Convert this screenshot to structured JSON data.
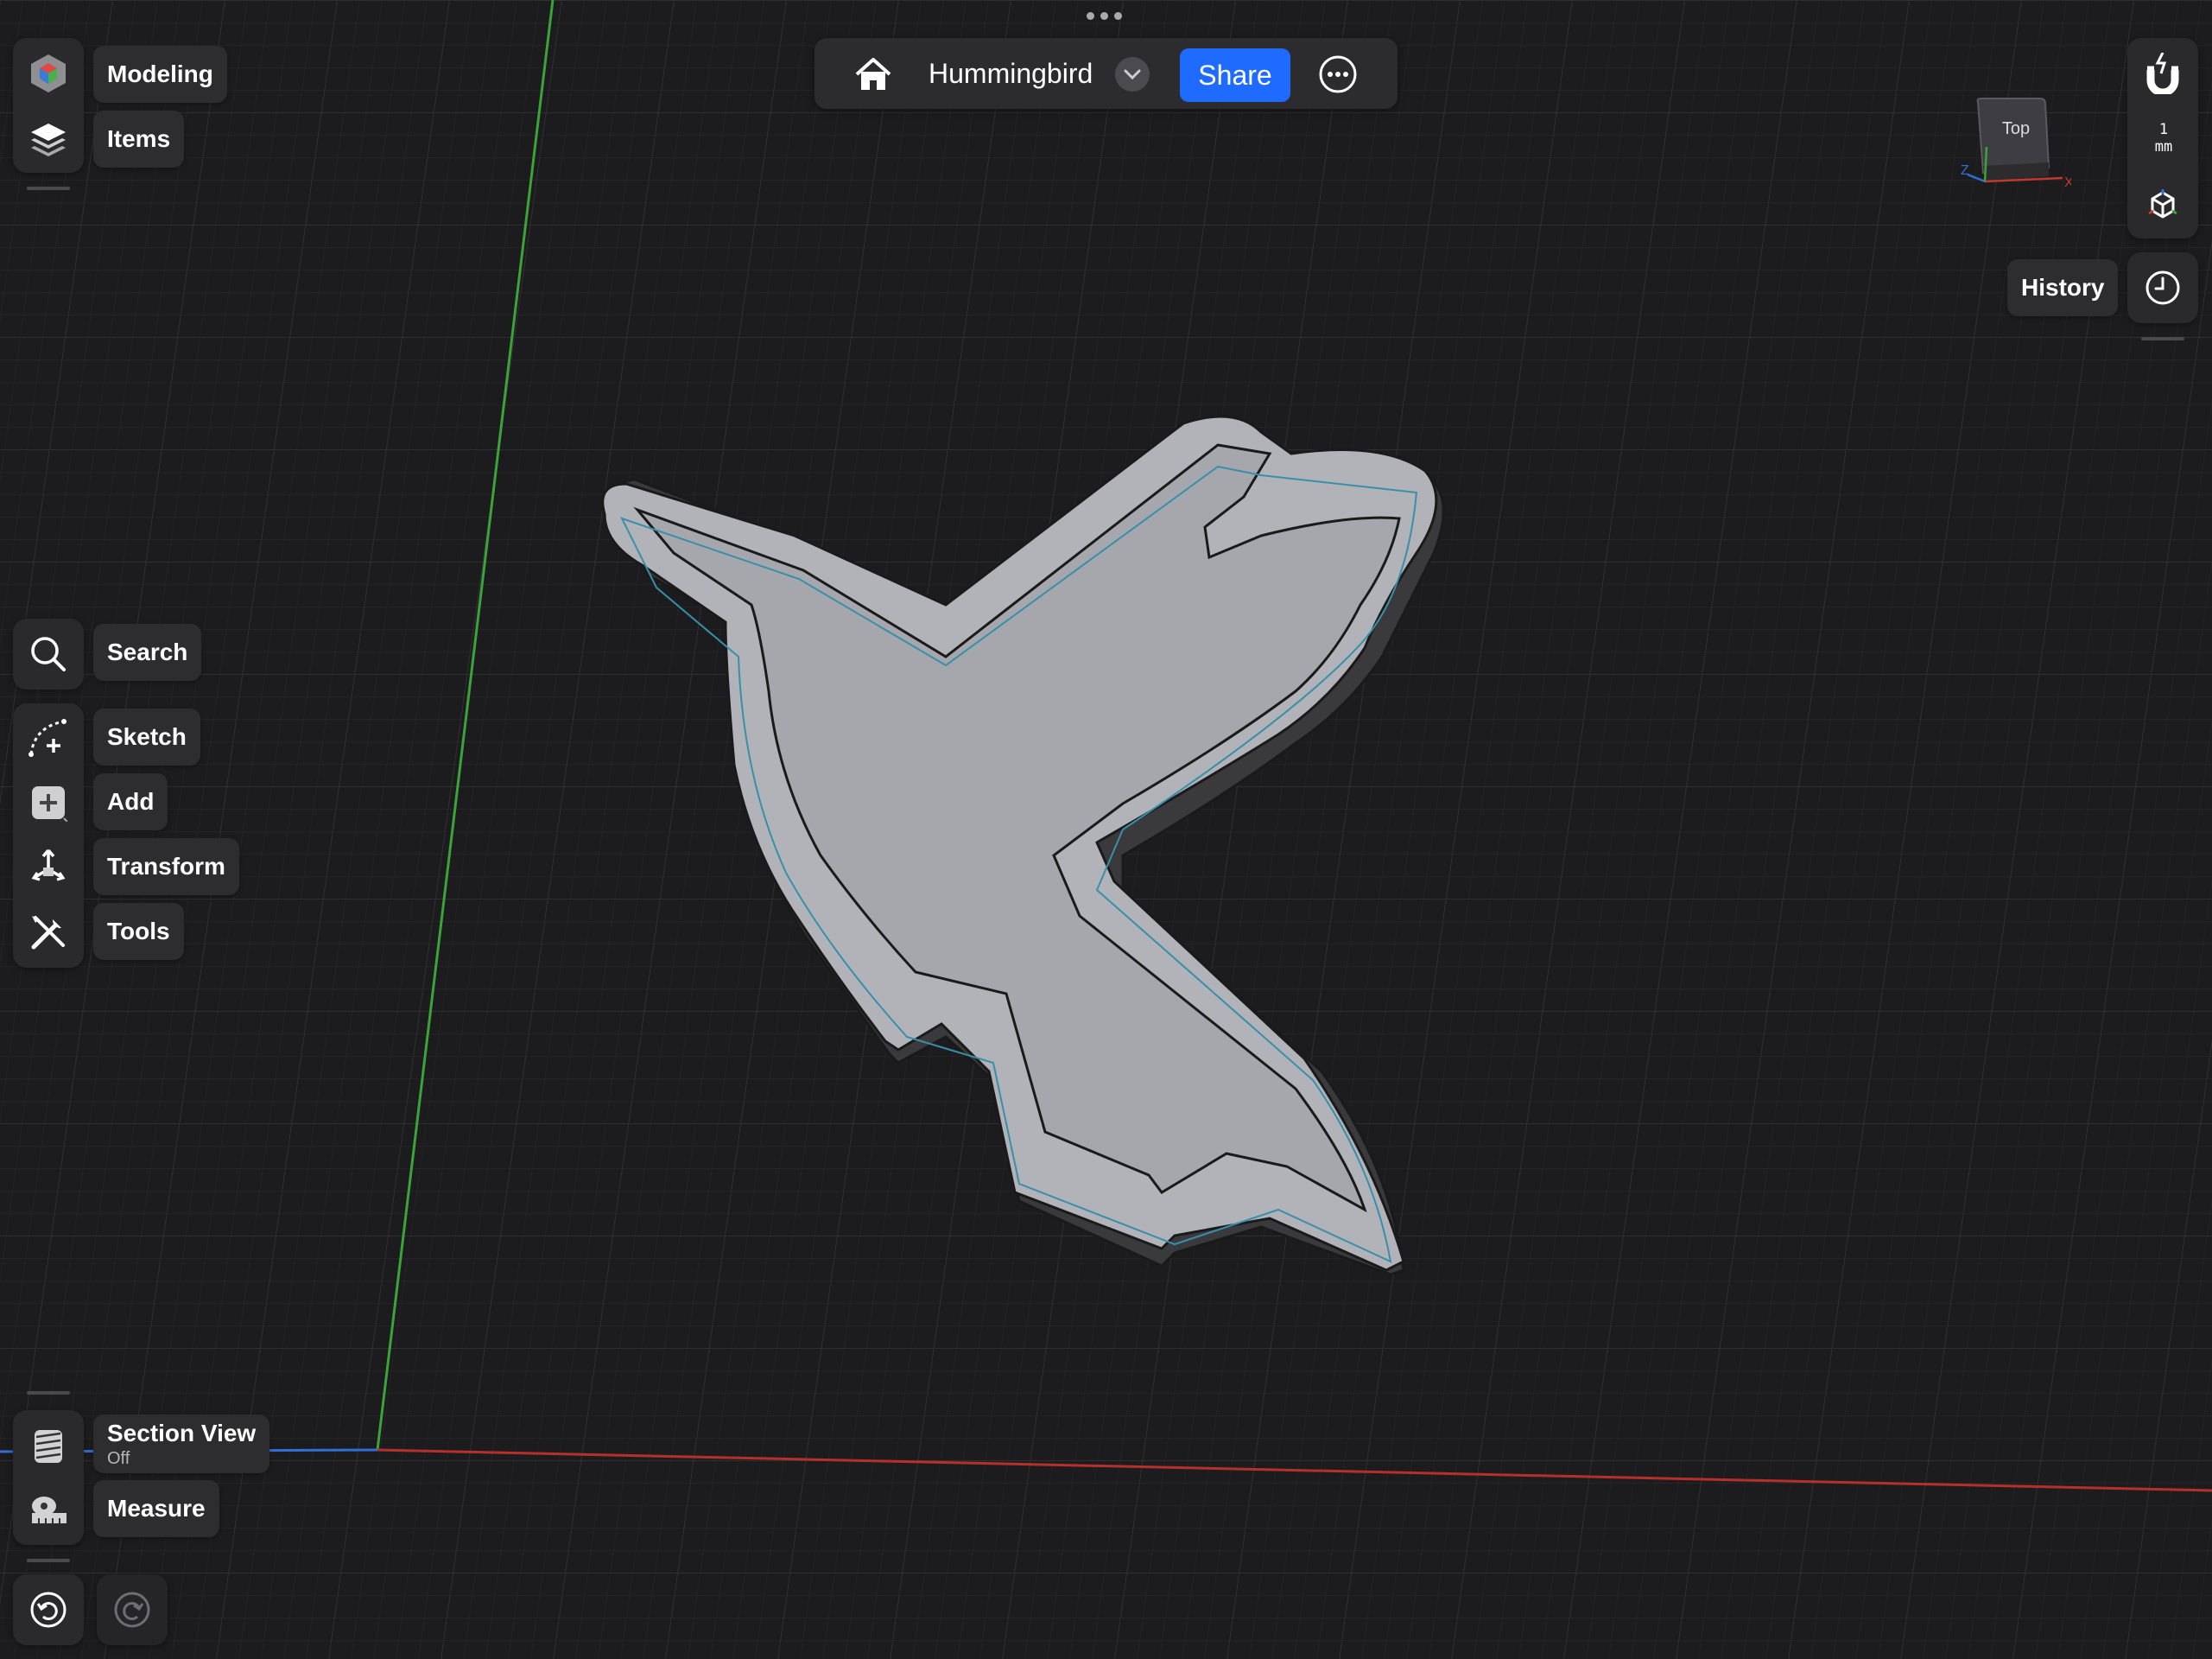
{
  "app": {
    "document_title": "Hummingbird",
    "share_label": "Share"
  },
  "left_top": {
    "modeling_label": "Modeling",
    "items_label": "Items"
  },
  "left_tools": {
    "search_label": "Search",
    "sketch_label": "Sketch",
    "add_label": "Add",
    "transform_label": "Transform",
    "tools_label": "Tools"
  },
  "left_bottom": {
    "section_view_label": "Section View",
    "section_view_state": "Off",
    "measure_label": "Measure"
  },
  "right_panel": {
    "grid_scale_value": "1",
    "grid_scale_unit": "mm",
    "history_label": "History",
    "viewcube_face": "Top",
    "axis_x": "X",
    "axis_z": "Z"
  },
  "colors": {
    "background": "#1c1c1e",
    "accent": "#1f6bff",
    "axis_x": "#c0392b",
    "axis_y": "#3aa33a",
    "axis_z": "#2f6fd6",
    "model_face": "#a9aab0"
  },
  "icons": [
    "home-icon",
    "chevron-down-icon",
    "more-icon",
    "modeling-cube-icon",
    "layers-icon",
    "search-icon",
    "sketch-icon",
    "add-icon",
    "transform-icon",
    "tools-icon",
    "section-view-icon",
    "measure-icon",
    "undo-icon",
    "redo-icon",
    "magnet-icon",
    "axis-gizmo-icon",
    "clock-icon"
  ]
}
